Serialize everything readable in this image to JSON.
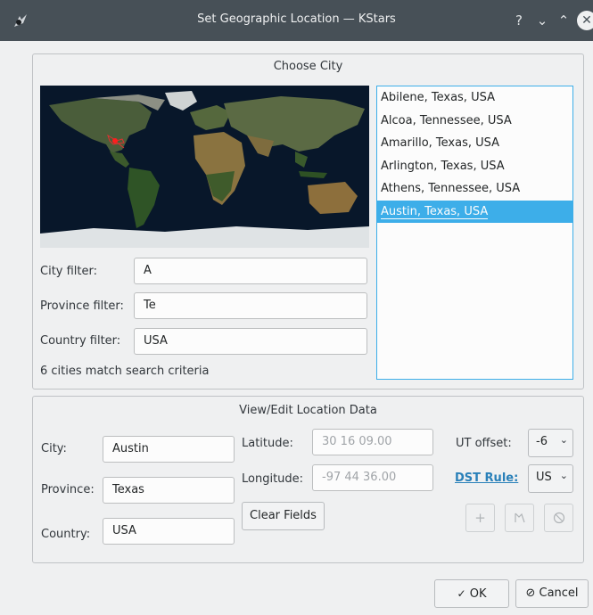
{
  "window": {
    "title": "Set Geographic Location — KStars",
    "buttons": [
      "?",
      "⌄",
      "⌃",
      "✕"
    ]
  },
  "choose_city": {
    "title": "Choose City",
    "city_filter": {
      "label": "City filter:",
      "value": "A"
    },
    "province_filter": {
      "label": "Province filter:",
      "value": "Te"
    },
    "country_filter": {
      "label": "Country filter:",
      "value": "USA"
    },
    "match_count": "6 cities match search criteria",
    "cities": [
      "Abilene, Texas, USA",
      "Alcoa, Tennessee, USA",
      "Amarillo, Texas, USA",
      "Arlington, Texas, USA",
      "Athens, Tennessee, USA",
      "Austin, Texas, USA"
    ],
    "selected_city": "Austin, Texas, USA"
  },
  "location_data": {
    "title": "View/Edit Location Data",
    "city": {
      "label": "City:",
      "value": "Austin"
    },
    "province": {
      "label": "Province:",
      "value": "Texas"
    },
    "country": {
      "label": "Country:",
      "value": "USA"
    },
    "latitude": {
      "label": "Latitude:",
      "value": "30 16 09.00"
    },
    "longitude": {
      "label": "Longitude:",
      "value": "-97 44 36.00"
    },
    "clear_fields": "Clear Fields",
    "ut_offset": {
      "label": "UT offset:",
      "value": "-6"
    },
    "dst_rule": {
      "label": "DST Rule:",
      "value": "US"
    },
    "add_icon": "plus-icon",
    "update_icon": "edit-icon",
    "remove_icon": "cancel-icon"
  },
  "footer": {
    "ok": "OK",
    "cancel": "Cancel"
  },
  "colors": {
    "accent": "#3daee9",
    "titlebar": "#475057",
    "link": "#2980b9"
  }
}
